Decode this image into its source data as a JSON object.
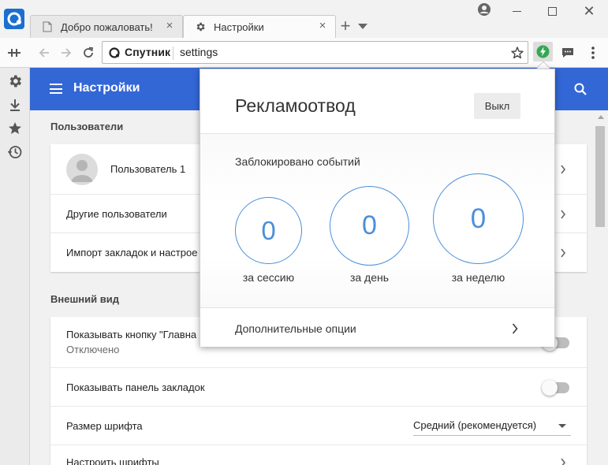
{
  "tabs": [
    {
      "title": "Добро пожаловать!",
      "icon": "page-icon"
    },
    {
      "title": "Настройки",
      "icon": "gear-icon"
    }
  ],
  "omnibox": {
    "site_name": "Спутник",
    "url": "settings"
  },
  "settings": {
    "title": "Настройки",
    "users_section": "Пользователи",
    "user_name": "Пользователь 1",
    "other_users": "Другие пользователи",
    "import_bookmarks": "Импорт закладок и настрое",
    "appearance_section": "Внешний вид",
    "show_home_button": "Показывать кнопку \"Главна",
    "show_home_button_state": "Отключено",
    "show_bookmarks_bar": "Показывать панель закладок",
    "font_size": "Размер шрифта",
    "font_size_value": "Средний (рекомендуется)",
    "customize_fonts": "Настроить шрифты"
  },
  "popup": {
    "title": "Рекламоотвод",
    "off_button": "Выкл",
    "blocked_label": "Заблокировано событий",
    "counters": [
      {
        "value": "0",
        "label": "за сессию"
      },
      {
        "value": "0",
        "label": "за день"
      },
      {
        "value": "0",
        "label": "за неделю"
      }
    ],
    "more_options": "Дополнительные опции"
  },
  "colors": {
    "header_blue": "#3367d6",
    "counter_blue": "#4a90d9",
    "ext_green": "#34a853"
  }
}
